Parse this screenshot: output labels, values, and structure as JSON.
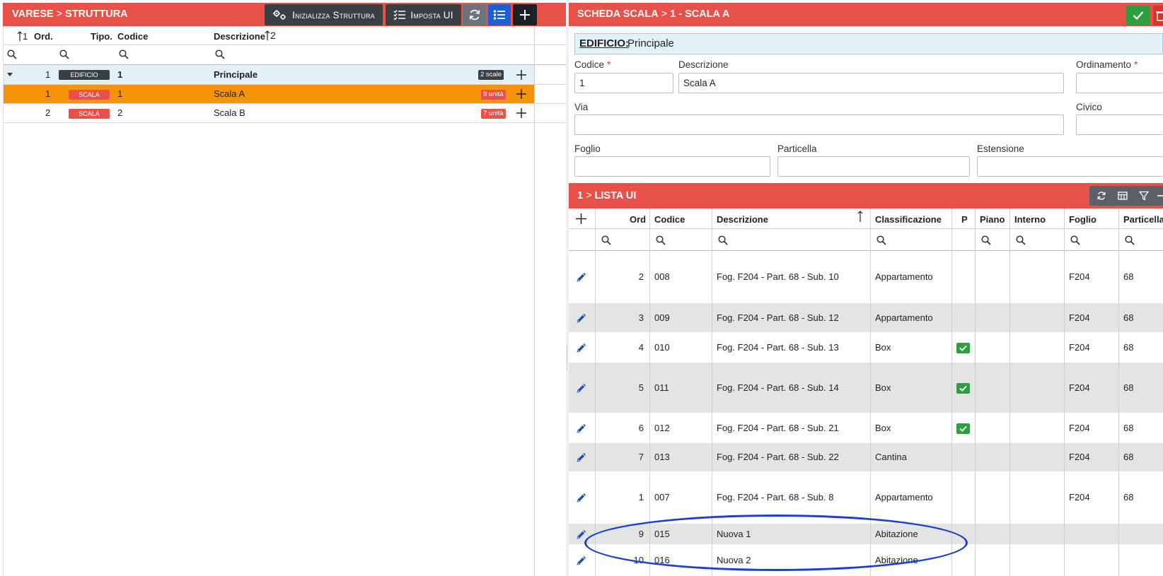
{
  "left_panel": {
    "breadcrumb": {
      "root": "VARESE",
      "sep": ">",
      "current": "STRUTTURA"
    },
    "toolbar": {
      "init_label": "Inizializza Struttura",
      "imposta_label": "Imposta UI"
    },
    "columns": {
      "ord_sort": "1",
      "ord": "Ord.",
      "tipo": "Tipo.",
      "codice": "Codice",
      "descrizione": "Descrizione",
      "desc_sort": "2"
    },
    "rows": [
      {
        "ord": "1",
        "tipo": "EDIFICIO",
        "codice": "1",
        "descrizione": "Principale",
        "count": "2 scale"
      },
      {
        "ord": "1",
        "tipo": "SCALA",
        "codice": "1",
        "descrizione": "Scala A",
        "count": "9 unità"
      },
      {
        "ord": "2",
        "tipo": "SCALA",
        "codice": "2",
        "descrizione": "Scala B",
        "count": "7 unità"
      }
    ]
  },
  "right_panel": {
    "breadcrumb": {
      "root": "SCHEDA SCALA",
      "sep": ">",
      "current": "1 - SCALA A"
    },
    "edificio": {
      "label": "EDIFICIO:",
      "value": "Principale"
    },
    "form": {
      "codice_label": "Codice",
      "codice_value": "1",
      "descrizione_label": "Descrizione",
      "descrizione_value": "Scala A",
      "ordinamento_label": "Ordinamento",
      "via_label": "Via",
      "civico_label": "Civico",
      "foglio_label": "Foglio",
      "particella_label": "Particella",
      "estensione_label": "Estensione",
      "required_mark": "*"
    },
    "lista": {
      "breadcrumb": {
        "root": "1",
        "sep": ">",
        "current": "LISTA UI"
      },
      "columns": {
        "ord": "Ord",
        "codice": "Codice",
        "descrizione": "Descrizione",
        "classificazione": "Classificazione",
        "p": "P",
        "piano": "Piano",
        "interno": "Interno",
        "foglio": "Foglio",
        "particella": "Particella"
      },
      "rows": [
        {
          "ord": "2",
          "codice": "008",
          "descrizione": "Fog. F204 - Part. 68 - Sub. 10",
          "classificazione": "Appartamento",
          "p": false,
          "foglio": "F204",
          "particella": "68"
        },
        {
          "ord": "3",
          "codice": "009",
          "descrizione": "Fog. F204 - Part. 68 - Sub. 12",
          "classificazione": "Appartamento",
          "p": false,
          "foglio": "F204",
          "particella": "68"
        },
        {
          "ord": "4",
          "codice": "010",
          "descrizione": "Fog. F204 - Part. 68 - Sub. 13",
          "classificazione": "Box",
          "p": true,
          "foglio": "F204",
          "particella": "68"
        },
        {
          "ord": "5",
          "codice": "011",
          "descrizione": "Fog. F204 - Part. 68 - Sub. 14",
          "classificazione": "Box",
          "p": true,
          "foglio": "F204",
          "particella": "68"
        },
        {
          "ord": "6",
          "codice": "012",
          "descrizione": "Fog. F204 - Part. 68 - Sub. 21",
          "classificazione": "Box",
          "p": true,
          "foglio": "F204",
          "particella": "68"
        },
        {
          "ord": "7",
          "codice": "013",
          "descrizione": "Fog. F204 - Part. 68 - Sub. 22",
          "classificazione": "Cantina",
          "p": false,
          "foglio": "F204",
          "particella": "68"
        },
        {
          "ord": "1",
          "codice": "007",
          "descrizione": "Fog. F204 - Part. 68 - Sub. 8",
          "classificazione": "Appartamento",
          "p": false,
          "foglio": "F204",
          "particella": "68"
        },
        {
          "ord": "9",
          "codice": "015",
          "descrizione": "Nuova 1",
          "classificazione": "Abitazione",
          "p": false,
          "foglio": "",
          "particella": ""
        },
        {
          "ord": "10",
          "codice": "016",
          "descrizione": "Nuova 2",
          "classificazione": "Abitazione",
          "p": false,
          "foglio": "",
          "particella": ""
        }
      ]
    }
  },
  "colors": {
    "header_red": "#e8514a",
    "selected_row": "#f5940b",
    "edificio_badge": "#3a3f44",
    "scala_badge": "#e8514a",
    "ok_green": "#2e9f40",
    "annotation_blue": "#1a3fd1"
  }
}
